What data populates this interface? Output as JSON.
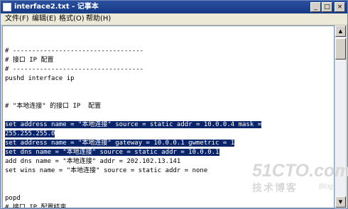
{
  "window": {
    "title": "interface2.txt - 记事本"
  },
  "menu": [
    {
      "label": "文件(F)"
    },
    {
      "label": "编辑(E)"
    },
    {
      "label": "格式(O)"
    },
    {
      "label": "帮助(H)"
    }
  ],
  "editor": {
    "lines": [
      "",
      "",
      "# ----------------------------------",
      "# 接口 IP 配置",
      "# ----------------------------------",
      "pushd interface ip",
      "",
      "",
      "# \"本地连接\" 的接口 IP  配置",
      "",
      "set address name = \"本地连接\" source = static addr = 10.0.0.4 mask =",
      "255.255.255.0",
      "set address name = \"本地连接\" gateway = 10.0.0.1 gwmetric = 1",
      "set dns name = \"本地连接\" source = static addr = 10.0.0.1",
      "add dns name = \"本地连接\" addr = 202.102.13.141",
      "set wins name = \"本地连接\" source = static addr = none",
      "",
      "",
      "popd",
      "# 接口 IP 配置结束"
    ],
    "selected_lines": [
      10,
      11,
      12,
      13
    ]
  },
  "watermark": {
    "main": "51CTO.com",
    "sub": "技术博客",
    "blog": "Blog"
  }
}
